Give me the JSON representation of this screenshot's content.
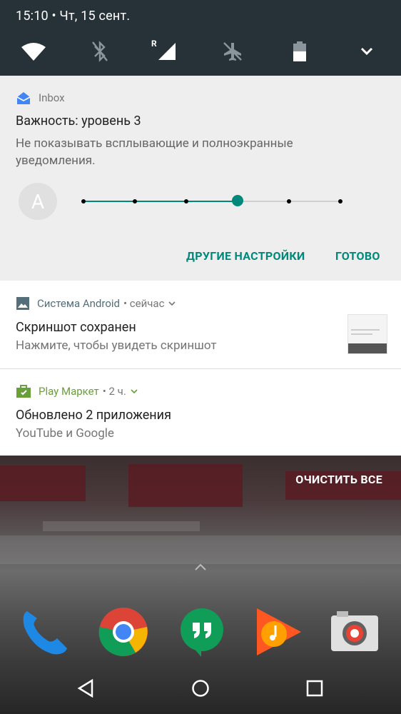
{
  "status_bar": {
    "time": "15:10 • Чт, 15 сент."
  },
  "quick_settings": {
    "icons": [
      "wifi-icon",
      "bluetooth-off-icon",
      "mobile-signal-roaming-icon",
      "airplane-mode-off-icon",
      "battery-icon",
      "chevron-down-icon"
    ],
    "roaming_label": "R"
  },
  "inbox_notification": {
    "app_name": "Inbox",
    "title": "Важность: уровень 3",
    "description": "Не показывать всплывающие и полноэкранные уведомления.",
    "avatar_letter": "A",
    "importance_level": 3,
    "importance_max": 5,
    "more_settings_label": "ДРУГИЕ НАСТРОЙКИ",
    "done_label": "ГОТОВО",
    "accent_color": "#00897b"
  },
  "screenshot_notification": {
    "app_name": "Система Android",
    "time": "• сейчас",
    "title": "Скриншот сохранен",
    "text": "Нажмите, чтобы увидеть скриншот"
  },
  "play_notification": {
    "app_name": "Play Маркет",
    "time": "• 2 ч.",
    "title": "Обновлено 2 приложения",
    "text": "YouTube и Google",
    "accent_color": "#689f38"
  },
  "clear_all_label": "ОЧИСТИТЬ ВСЕ",
  "dock": [
    "phone-icon",
    "chrome-icon",
    "hangouts-icon",
    "play-music-icon",
    "camera-icon"
  ],
  "nav_bar": [
    "back-icon",
    "home-icon",
    "recents-icon"
  ]
}
